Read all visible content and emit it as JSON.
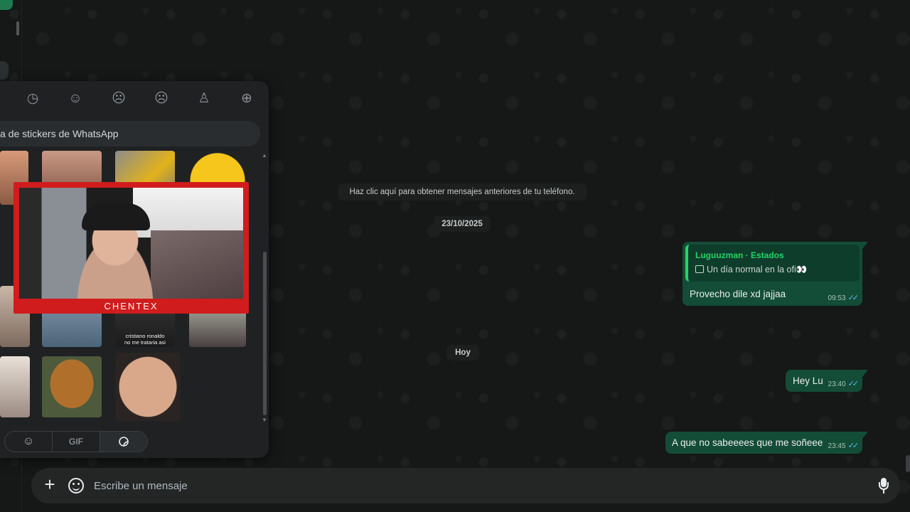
{
  "sticker_panel": {
    "categories": [
      "clock-icon",
      "smile-icon",
      "frown-icon",
      "sad-icon",
      "cake-icon",
      "add-circle-icon"
    ],
    "search_text": "a de stickers de WhatsApp",
    "sticker_caption": "cristiano ronaldo\nno me trataria asi",
    "tabs": {
      "emoji": "☺",
      "gif": "GIF",
      "stickers": "sticker"
    }
  },
  "webcam": {
    "label": "CHENTEX"
  },
  "chat": {
    "system_message": "Haz clic aquí para obtener mensajes anteriores de tu teléfono.",
    "date_1": "23/10/2025",
    "date_2": "Hoy",
    "messages": [
      {
        "quote_author": "Luguuzman · Estados",
        "quote_text": "Un día normal en la ofi👀",
        "text": "Provecho dile xd jajjaa",
        "time": "09:53"
      },
      {
        "text": "Hey Lu",
        "time": "23:40"
      },
      {
        "text": "A que no sabeeees que me soñeee",
        "time": "23:45"
      }
    ]
  },
  "composer": {
    "placeholder": "Escribe un mensaje"
  },
  "colors": {
    "outgoing_bubble": "#144d37",
    "accent": "#25d366",
    "read_ticks": "#53bdeb",
    "webcam_frame": "#d01c1c"
  }
}
